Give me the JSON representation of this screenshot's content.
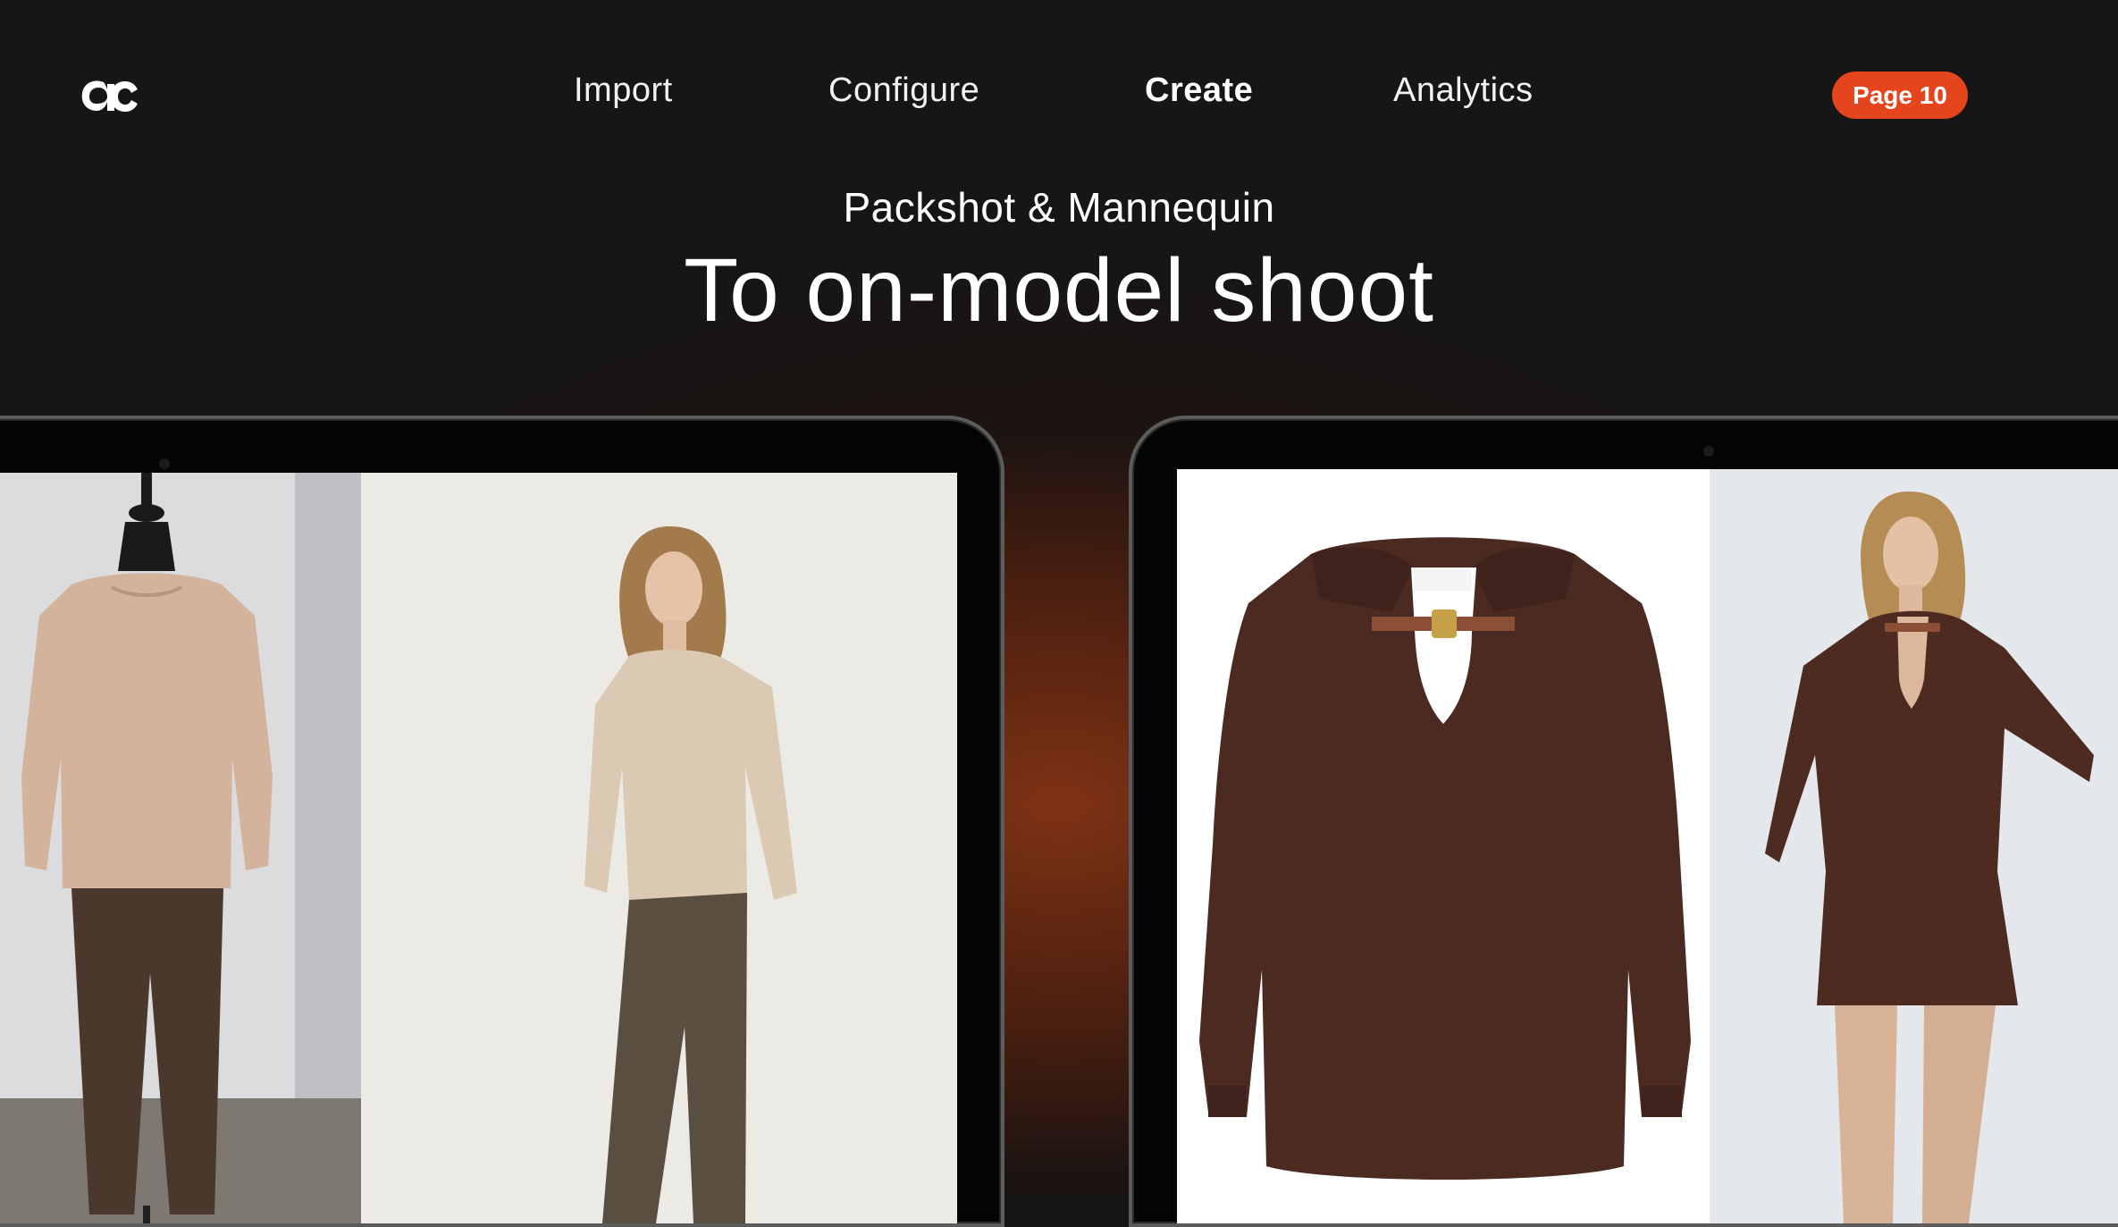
{
  "header": {
    "nav": [
      {
        "label": "Import"
      },
      {
        "label": "Configure"
      },
      {
        "label": "Create"
      },
      {
        "label": "Analytics"
      }
    ],
    "active_nav": "Create",
    "page_badge": "Page 10"
  },
  "hero": {
    "subtitle": "Packshot & Mannequin",
    "title": "To on-model shoot"
  },
  "colors": {
    "background": "#161616",
    "accent": "#e4451c",
    "glow": "#84341e"
  },
  "icons": [
    "ac-logo-icon"
  ]
}
